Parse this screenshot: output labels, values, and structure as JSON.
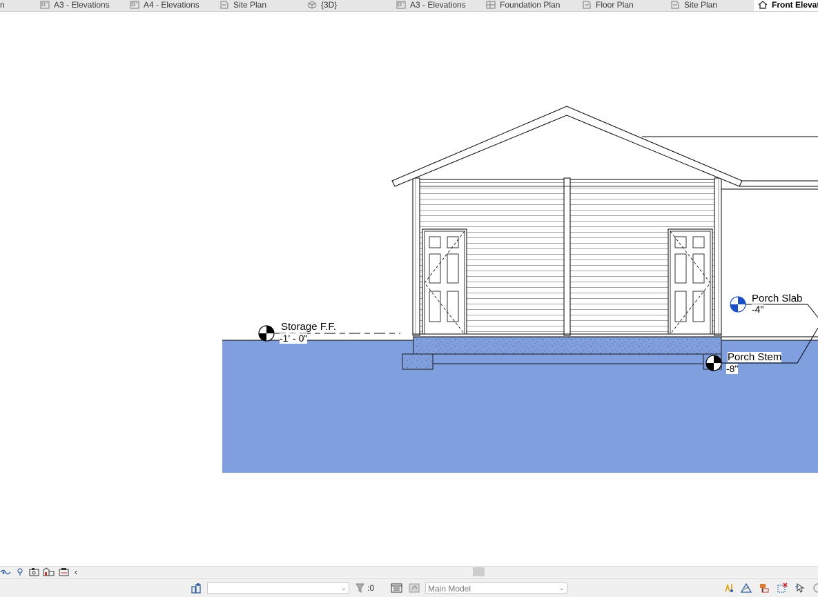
{
  "tabs": [
    {
      "label": "n",
      "icon": "none"
    },
    {
      "label": "A3 - Elevations",
      "icon": "sheet-icon"
    },
    {
      "label": "A4 - Elevations",
      "icon": "sheet-icon"
    },
    {
      "label": "Site Plan",
      "icon": "floor-plan-icon"
    },
    {
      "label": "{3D}",
      "icon": "3d-view-icon"
    },
    {
      "label": "A3 - Elevations",
      "icon": "sheet-icon"
    },
    {
      "label": "Foundation Plan",
      "icon": "floor-plan-icon"
    },
    {
      "label": "Floor Plan",
      "icon": "floor-plan-icon"
    },
    {
      "label": "Site Plan",
      "icon": "floor-plan-icon"
    },
    {
      "label": "Front Elevat",
      "icon": "elevation-icon",
      "active": true
    }
  ],
  "levels": {
    "storage": {
      "name": "Storage F.F.",
      "elevation": "-1' - 0\""
    },
    "porch_slab": {
      "name": "Porch Slab",
      "elevation": "-4\""
    },
    "porch_stem": {
      "name": "Porch Stem",
      "elevation": "-8\""
    }
  },
  "colors": {
    "ground": "#809fdf",
    "level_head_blue": "#1c4fc4"
  },
  "statusbar": {
    "workset_value": "",
    "selection_count": ":0",
    "model_value": "Main Model"
  }
}
